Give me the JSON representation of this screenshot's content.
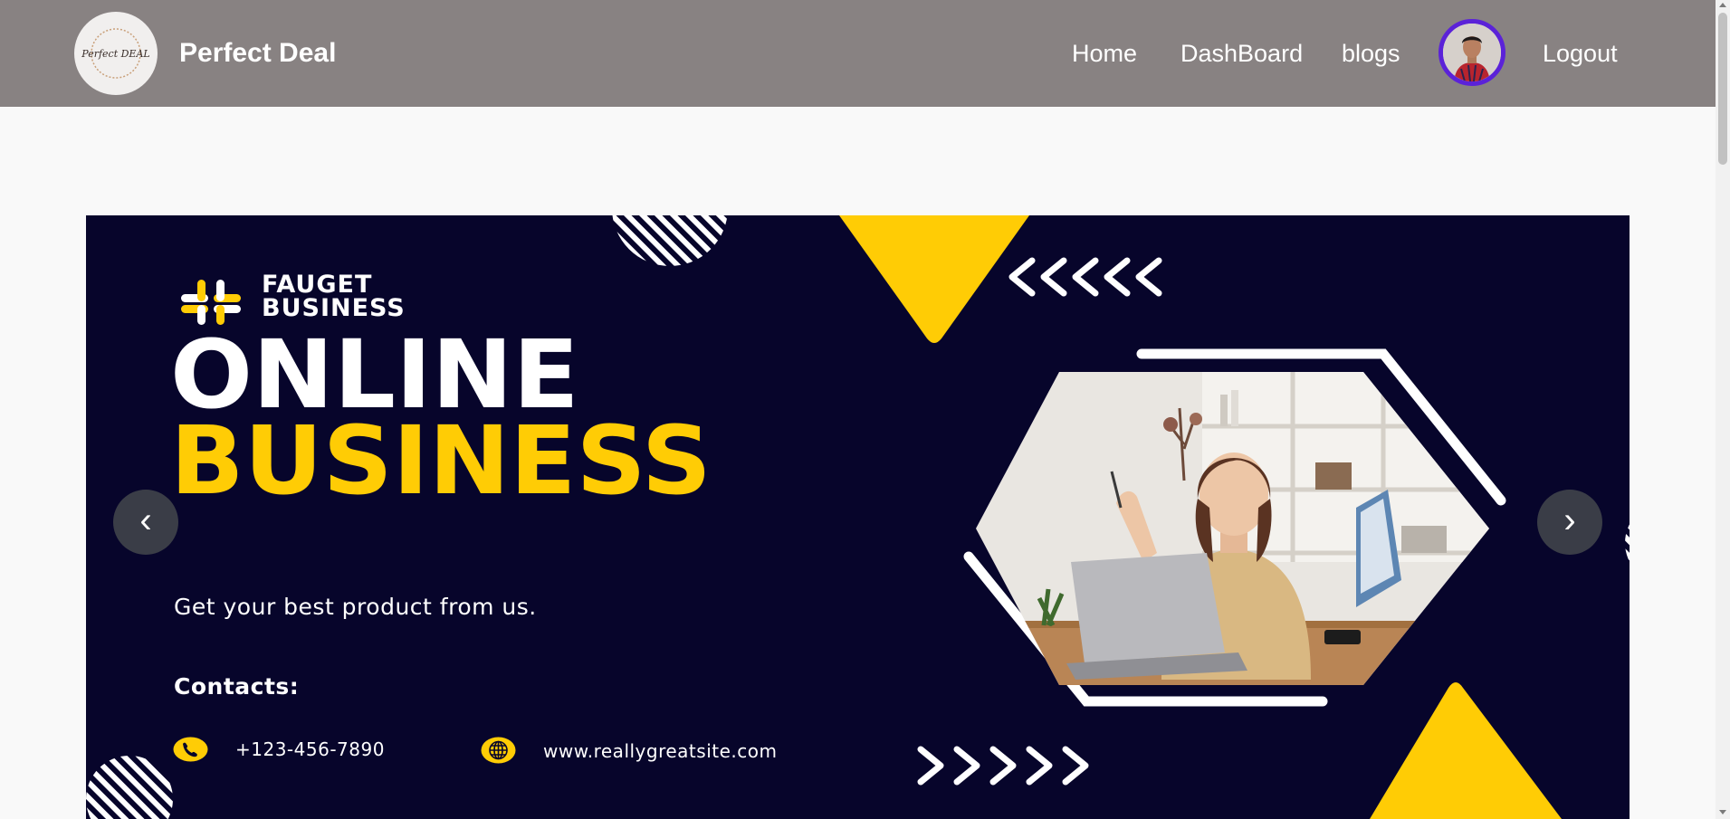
{
  "navbar": {
    "brand_name": "Perfect Deal",
    "brand_logo_text": "Perfect DEAL",
    "links": {
      "home": "Home",
      "dashboard": "DashBoard",
      "blogs": "blogs",
      "logout": "Logout"
    },
    "background_color": "#888282"
  },
  "carousel": {
    "slide": {
      "brand_line_1": "FAUGET",
      "brand_line_2": "BUSINESS",
      "headline_line_1": "ONLINE",
      "headline_line_2": "BUSINESS",
      "tagline": "Get your best product from us.",
      "contacts_title": "Contacts:",
      "phone": "+123-456-7890",
      "website": "www.reallygreatsite.com",
      "background_color": "#07052b",
      "accent_color": "#ffcc05"
    },
    "prev_label": "‹",
    "next_label": "›"
  },
  "icons": [
    "brand-logo-icon",
    "avatar-icon",
    "slack-style-logo-icon",
    "phone-icon",
    "globe-icon",
    "chevron-left-icon",
    "chevron-right-icon"
  ]
}
